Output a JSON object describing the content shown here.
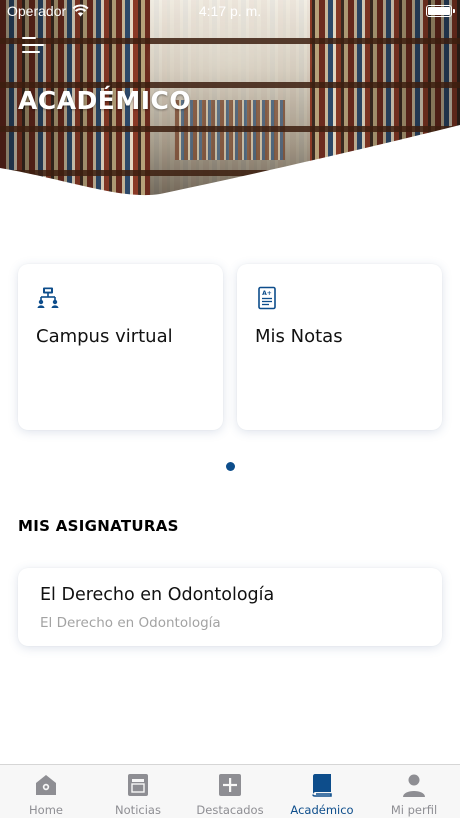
{
  "status_bar": {
    "carrier": "Operador",
    "time": "4:17 p. m."
  },
  "header": {
    "title": "ACADÉMICO"
  },
  "quick_access": [
    {
      "label": "Campus virtual",
      "icon": "campus-network-icon"
    },
    {
      "label": "Mis Notas",
      "icon": "grades-document-icon"
    }
  ],
  "pager": {
    "pages": 1,
    "current": 1
  },
  "subjects_section": {
    "title": "MIS ASIGNATURAS",
    "items": [
      {
        "name": "El Derecho en Odontología",
        "subtitle": "El Derecho en Odontología"
      }
    ]
  },
  "tab_bar": {
    "active": "Académico",
    "tabs": [
      {
        "label": "Home",
        "icon": "home-icon"
      },
      {
        "label": "Noticias",
        "icon": "news-icon"
      },
      {
        "label": "Destacados",
        "icon": "plus-icon"
      },
      {
        "label": "Académico",
        "icon": "book-icon"
      },
      {
        "label": "Mi perfil",
        "icon": "person-icon"
      }
    ]
  },
  "colors": {
    "accent": "#0d4d8b",
    "inactive_tab": "#8e8e93",
    "tab_bar_bg": "#f7f7f7",
    "secondary_text": "#a3a3a3"
  }
}
